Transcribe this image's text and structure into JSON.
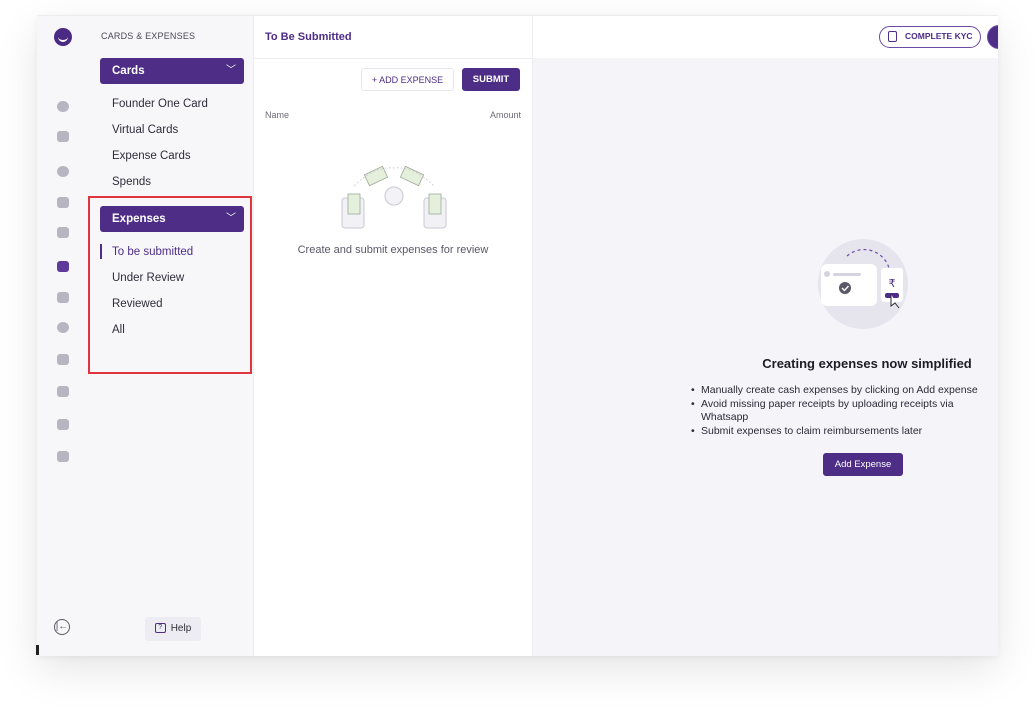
{
  "nav": {
    "section_title": "CARDS & EXPENSES",
    "cards_section": {
      "label": "Cards",
      "items": [
        "Founder One Card",
        "Virtual Cards",
        "Expense Cards",
        "Spends"
      ]
    },
    "expenses_section": {
      "label": "Expenses",
      "items": [
        "To be submitted",
        "Under Review",
        "Reviewed",
        "All"
      ],
      "active_index": 0
    },
    "help_label": "Help"
  },
  "header": {
    "title": "To Be Submitted",
    "kyc_label": "COMPLETE KYC"
  },
  "list": {
    "add_expense_label": "+ ADD EXPENSE",
    "submit_label": "SUBMIT",
    "columns": [
      "Name",
      "Amount"
    ],
    "empty_text": "Create and submit expenses for review"
  },
  "promo": {
    "title": "Creating expenses now simplified",
    "bullets": [
      "Manually create cash expenses by clicking on Add expense",
      "Avoid missing paper receipts by uploading receipts via Whatsapp",
      "Submit expenses to claim reimbursements later"
    ],
    "button_label": "Add Expense",
    "currency_symbol": "₹"
  },
  "colors": {
    "brand": "#4d2d86",
    "highlight": "#e0343f"
  },
  "rail_icons": [
    "bulb-icon",
    "card-icon",
    "coin-icon",
    "basket-icon",
    "box-icon",
    "expense-card-icon",
    "bank-icon",
    "money-bag-icon",
    "grid-icon",
    "bill-icon",
    "settings-icon",
    "apps-icon"
  ]
}
